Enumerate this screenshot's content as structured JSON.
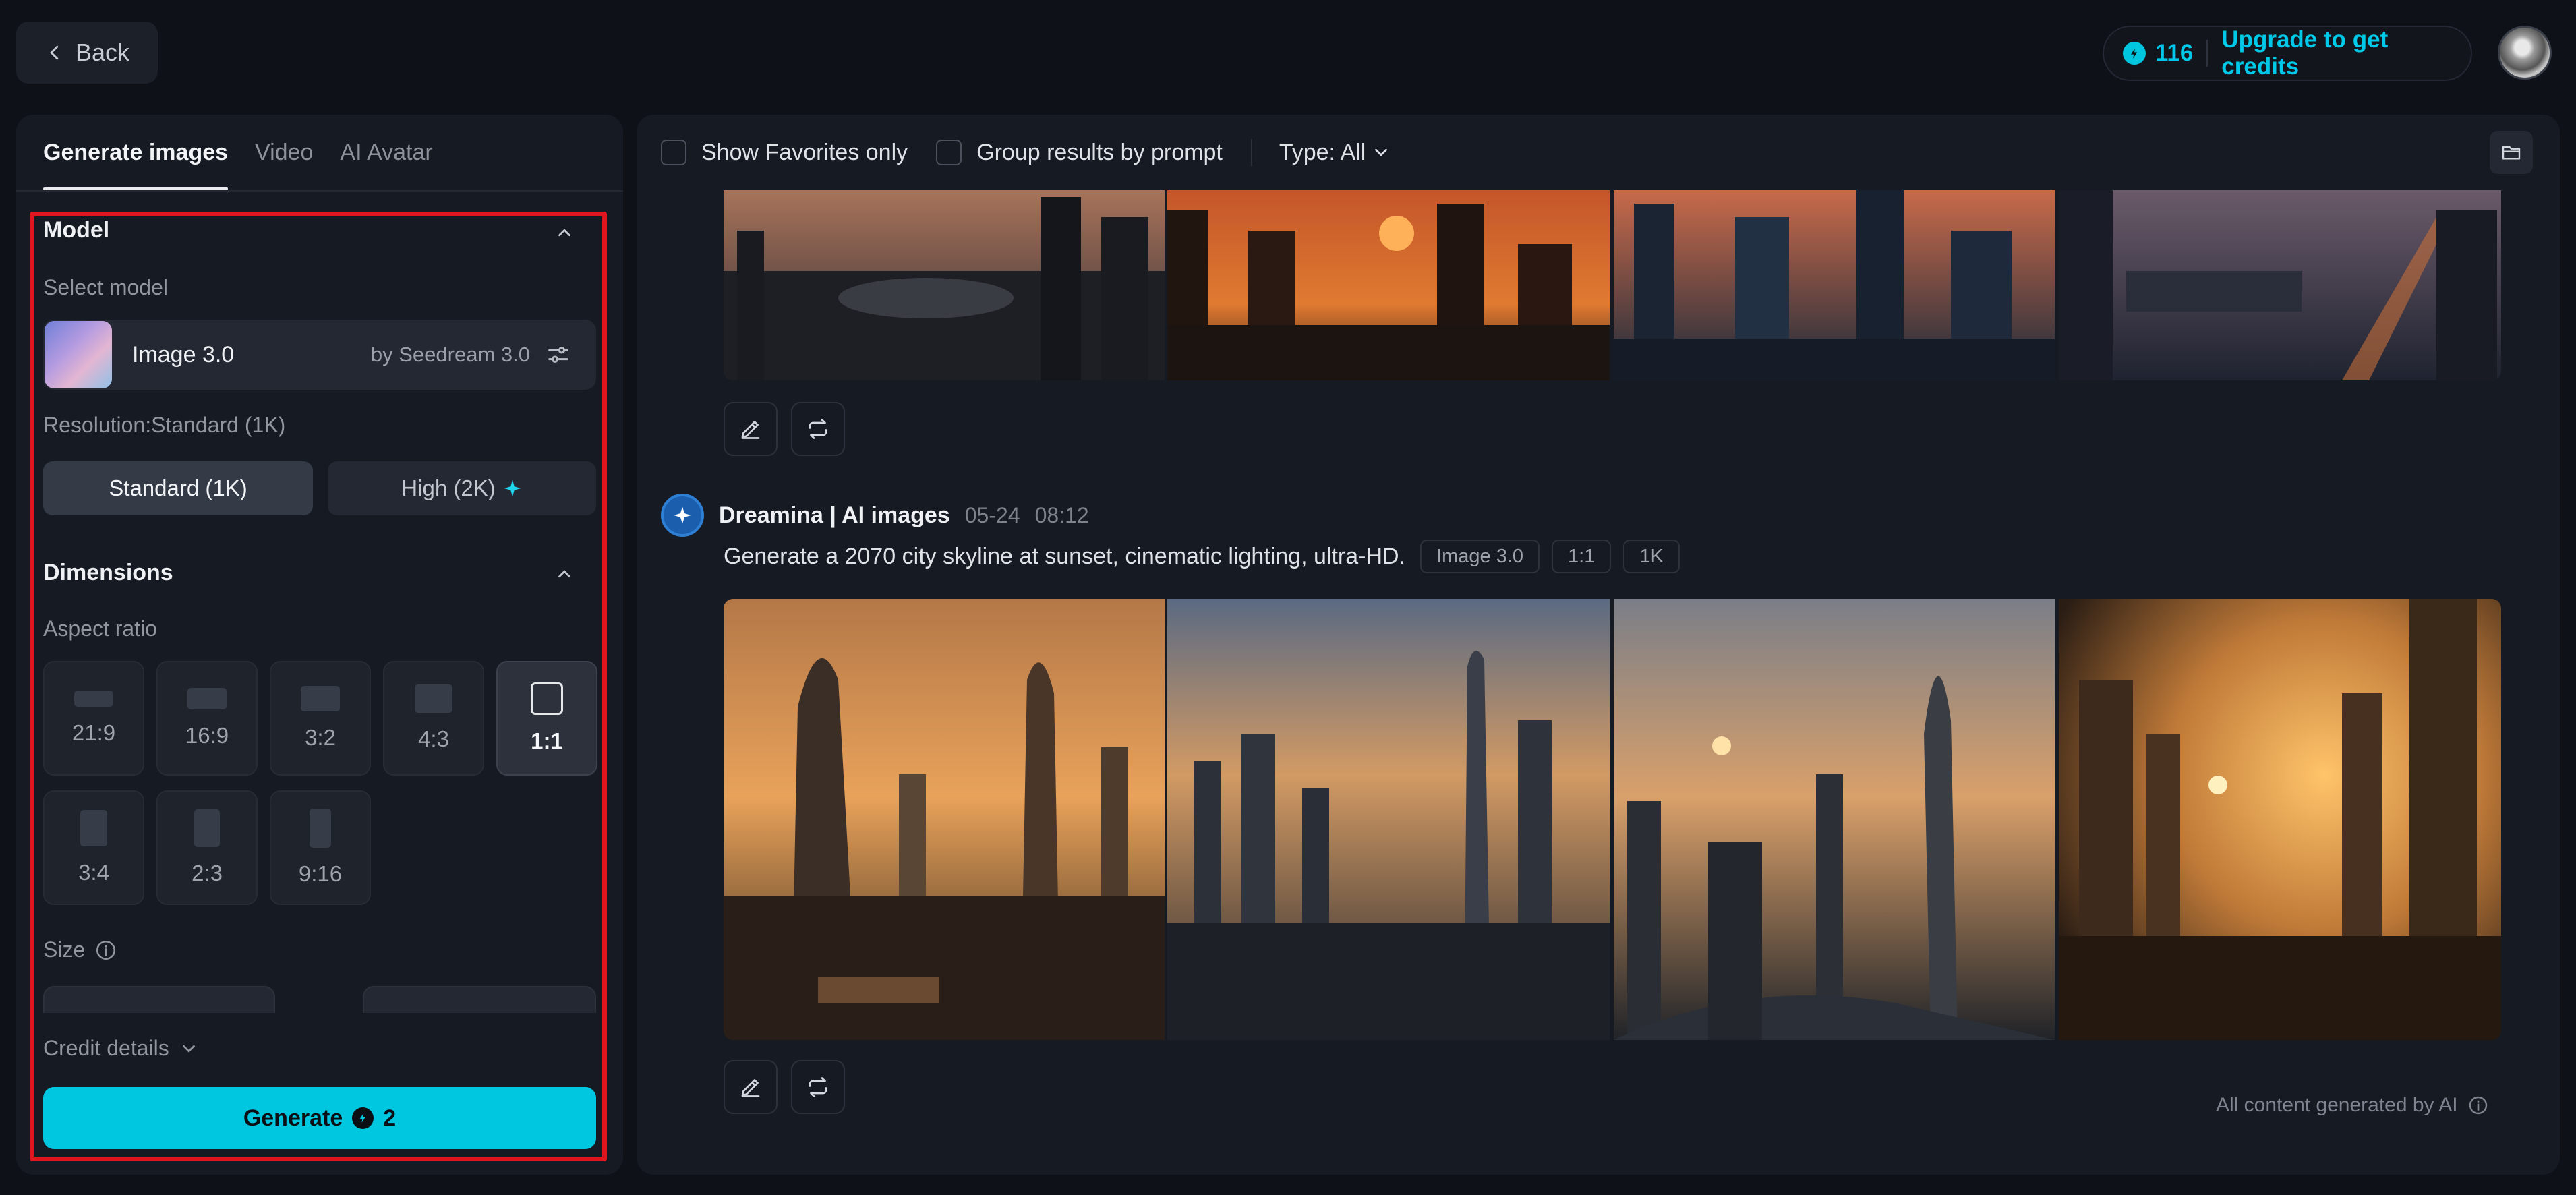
{
  "header": {
    "back_label": "Back",
    "credits_count": "116",
    "upgrade_label": "Upgrade to get credits"
  },
  "left": {
    "tabs": [
      {
        "label": "Generate images",
        "active": true
      },
      {
        "label": "Video",
        "active": false
      },
      {
        "label": "AI Avatar",
        "active": false
      }
    ],
    "model": {
      "section_title": "Model",
      "select_label": "Select model",
      "name": "Image 3.0",
      "by": "by Seedream 3.0"
    },
    "resolution": {
      "label": "Resolution:Standard (1K)",
      "options": [
        "Standard (1K)",
        "High (2K)"
      ],
      "selected": "Standard (1K)"
    },
    "dimensions": {
      "section_title": "Dimensions",
      "aspect_label": "Aspect ratio",
      "ratios": [
        "21:9",
        "16:9",
        "3:2",
        "4:3",
        "1:1",
        "3:4",
        "2:3",
        "9:16"
      ],
      "selected": "1:1"
    },
    "size_label": "Size",
    "credit_details": "Credit details",
    "generate_label": "Generate",
    "generate_cost": "2"
  },
  "right": {
    "toolbar": {
      "favorites_label": "Show Favorites only",
      "group_label": "Group results by prompt",
      "type_label": "Type: All"
    },
    "generation": {
      "author": "Dreamina | AI images",
      "date": "05-24",
      "time": "08:12",
      "prompt": "Generate a 2070 city skyline at sunset, cinematic lighting, ultra-HD.",
      "tags": [
        "Image 3.0",
        "1:1",
        "1K"
      ]
    },
    "footer_note": "All content generated by AI"
  },
  "colors": {
    "accent": "#00c7e0",
    "highlight_box": "#e0161e",
    "background": "#0e1117",
    "panel": "#161a22"
  }
}
